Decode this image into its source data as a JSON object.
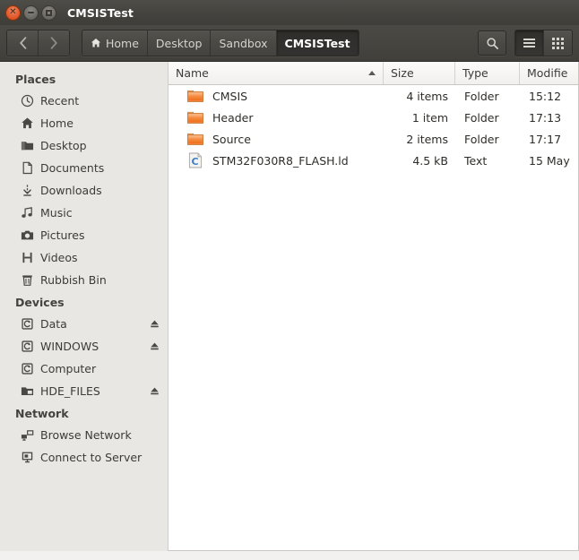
{
  "window": {
    "title": "CMSISTest",
    "controls": {
      "close": "close-button",
      "minimize": "minimize-button",
      "maximize": "maximize-button"
    }
  },
  "toolbar": {
    "back_label": "‹",
    "forward_label": "›",
    "search_icon": "search-icon",
    "list_view_icon": "list-view-icon",
    "grid_view_icon": "grid-view-icon",
    "breadcrumbs": [
      {
        "label": "Home",
        "icon": "home-icon",
        "active": false
      },
      {
        "label": "Desktop",
        "icon": "",
        "active": false
      },
      {
        "label": "Sandbox",
        "icon": "",
        "active": false
      },
      {
        "label": "CMSISTest",
        "icon": "",
        "active": true
      }
    ]
  },
  "sidebar": {
    "sections": [
      {
        "title": "Places",
        "items": [
          {
            "label": "Recent",
            "icon": "clock-icon",
            "eject": false
          },
          {
            "label": "Home",
            "icon": "home-icon",
            "eject": false
          },
          {
            "label": "Desktop",
            "icon": "desktop-folder-icon",
            "eject": false
          },
          {
            "label": "Documents",
            "icon": "document-icon",
            "eject": false
          },
          {
            "label": "Downloads",
            "icon": "download-icon",
            "eject": false
          },
          {
            "label": "Music",
            "icon": "music-note-icon",
            "eject": false
          },
          {
            "label": "Pictures",
            "icon": "camera-icon",
            "eject": false
          },
          {
            "label": "Videos",
            "icon": "film-icon",
            "eject": false
          },
          {
            "label": "Rubbish Bin",
            "icon": "trash-icon",
            "eject": false
          }
        ]
      },
      {
        "title": "Devices",
        "items": [
          {
            "label": "Data",
            "icon": "drive-icon",
            "eject": true
          },
          {
            "label": "WINDOWS",
            "icon": "drive-icon",
            "eject": true
          },
          {
            "label": "Computer",
            "icon": "drive-icon",
            "eject": false
          },
          {
            "label": "HDE_FILES",
            "icon": "removable-drive-icon",
            "eject": true
          }
        ]
      },
      {
        "title": "Network",
        "items": [
          {
            "label": "Browse Network",
            "icon": "network-icon",
            "eject": false
          },
          {
            "label": "Connect to Server",
            "icon": "server-icon",
            "eject": false
          }
        ]
      }
    ]
  },
  "file_list": {
    "columns": {
      "name": "Name",
      "size": "Size",
      "type": "Type",
      "modified": "Modifie"
    },
    "sort": {
      "column": "Name",
      "direction": "ascending"
    },
    "rows": [
      {
        "icon": "folder-icon",
        "name": "CMSIS",
        "size": "4 items",
        "type": "Folder",
        "modified": "15:12"
      },
      {
        "icon": "folder-icon",
        "name": "Header",
        "size": "1 item",
        "type": "Folder",
        "modified": "17:13"
      },
      {
        "icon": "folder-icon",
        "name": "Source",
        "size": "2 items",
        "type": "Folder",
        "modified": "17:17"
      },
      {
        "icon": "text-file-icon",
        "name": "STM32F030R8_FLASH.ld",
        "size": "4.5 kB",
        "type": "Text",
        "modified": "15 May"
      }
    ]
  },
  "colors": {
    "titlebar": "#45433e",
    "toolbar": "#474540",
    "sidebar": "#e8e7e4",
    "list_background": "#ffffff",
    "folder_accent": "#f07a34",
    "close_button": "#e8633a"
  }
}
